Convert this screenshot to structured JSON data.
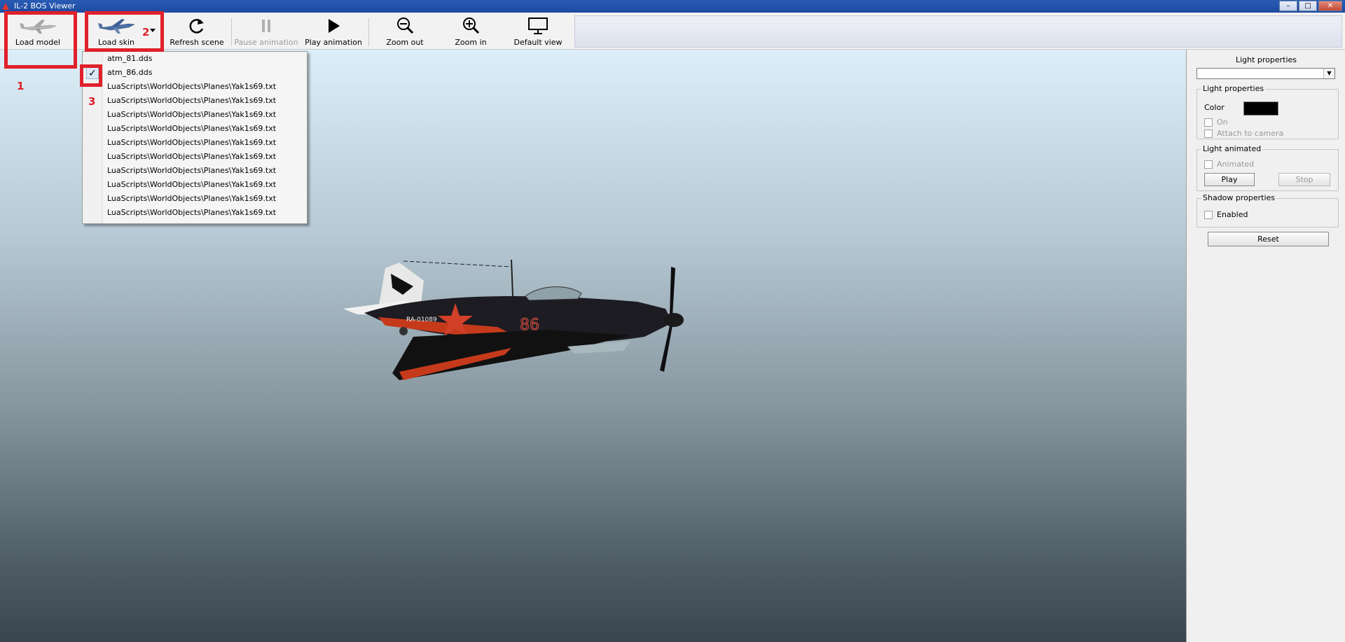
{
  "window": {
    "title": "IL-2 BOS Viewer",
    "controls": [
      "–",
      "□",
      "✕"
    ]
  },
  "toolbar": {
    "load_model": "Load model",
    "load_skin": "Load skin",
    "refresh_scene": "Refresh scene",
    "pause_animation": "Pause animation",
    "play_animation": "Play animation",
    "zoom_out": "Zoom out",
    "zoom_in": "Zoom in",
    "default_view": "Default view"
  },
  "skin_menu": {
    "items": [
      {
        "label": "atm_81.dds",
        "checked": false
      },
      {
        "label": "atm_86.dds",
        "checked": true
      },
      {
        "label": "LuaScripts\\WorldObjects\\Planes\\Yak1s69.txt",
        "checked": false
      },
      {
        "label": "LuaScripts\\WorldObjects\\Planes\\Yak1s69.txt",
        "checked": false
      },
      {
        "label": "LuaScripts\\WorldObjects\\Planes\\Yak1s69.txt",
        "checked": false
      },
      {
        "label": "LuaScripts\\WorldObjects\\Planes\\Yak1s69.txt",
        "checked": false
      },
      {
        "label": "LuaScripts\\WorldObjects\\Planes\\Yak1s69.txt",
        "checked": false
      },
      {
        "label": "LuaScripts\\WorldObjects\\Planes\\Yak1s69.txt",
        "checked": false
      },
      {
        "label": "LuaScripts\\WorldObjects\\Planes\\Yak1s69.txt",
        "checked": false
      },
      {
        "label": "LuaScripts\\WorldObjects\\Planes\\Yak1s69.txt",
        "checked": false
      },
      {
        "label": "LuaScripts\\WorldObjects\\Planes\\Yak1s69.txt",
        "checked": false
      },
      {
        "label": "LuaScripts\\WorldObjects\\Planes\\Yak1s69.txt",
        "checked": false
      }
    ],
    "check_mark": "✓"
  },
  "annotations": {
    "n1": "1",
    "n2": "2",
    "n3": "3",
    "color": "#e0202a"
  },
  "plane": {
    "code": "RA-01089",
    "number": "86"
  },
  "panel": {
    "title": "Light properties",
    "select_value": "",
    "light_group_title": "Light properties",
    "color_label": "Color",
    "color_value": "#000000",
    "on_label": "On",
    "attach_label": "Attach to camera",
    "animated_group_title": "Light animated",
    "animated_label": "Animated",
    "play_label": "Play",
    "stop_label": "Stop",
    "shadow_group_title": "Shadow properties",
    "enabled_label": "Enabled",
    "reset_label": "Reset"
  }
}
